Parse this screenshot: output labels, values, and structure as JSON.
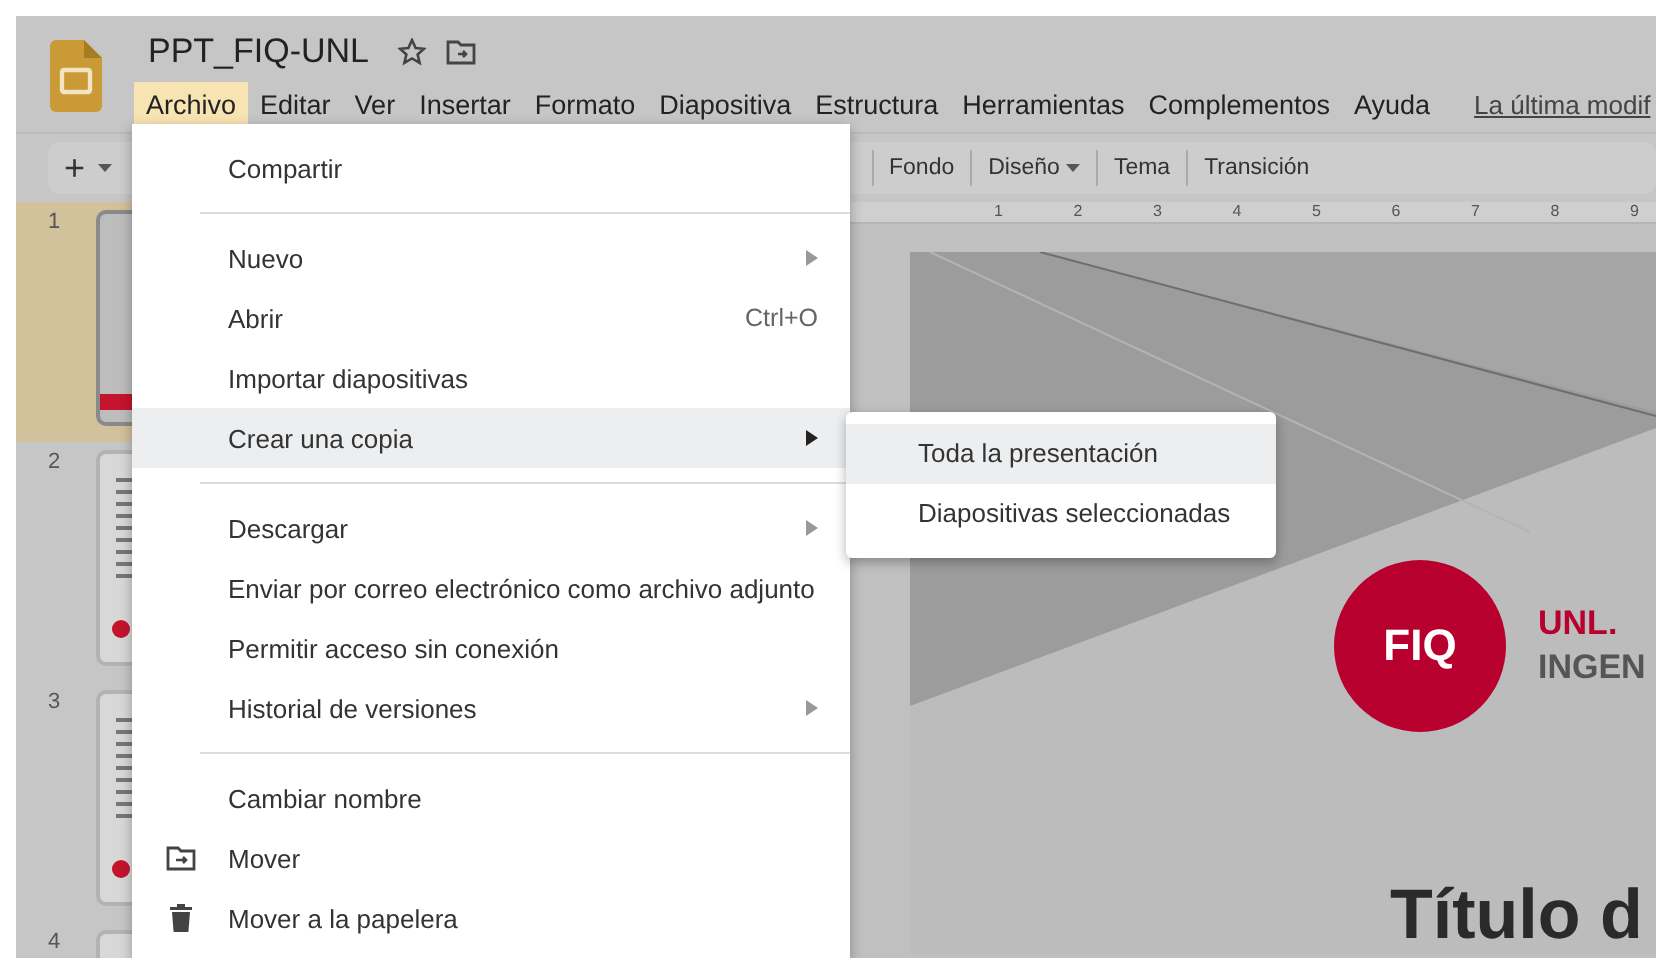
{
  "document": {
    "title": "PPT_FIQ-UNL",
    "starred": false,
    "last_edit": "La última modif"
  },
  "menus": [
    {
      "label": "Archivo",
      "selected": true
    },
    {
      "label": "Editar",
      "selected": false
    },
    {
      "label": "Ver",
      "selected": false
    },
    {
      "label": "Insertar",
      "selected": false
    },
    {
      "label": "Formato",
      "selected": false
    },
    {
      "label": "Diapositiva",
      "selected": false
    },
    {
      "label": "Estructura",
      "selected": false
    },
    {
      "label": "Herramientas",
      "selected": false
    },
    {
      "label": "Complementos",
      "selected": false
    },
    {
      "label": "Ayuda",
      "selected": false
    }
  ],
  "toolbar": {
    "add": "+",
    "tools": [
      {
        "label": "Fondo",
        "kind": "plain"
      },
      {
        "label": "Diseño",
        "kind": "dropdown"
      },
      {
        "label": "Tema",
        "kind": "plain"
      },
      {
        "label": "Transición",
        "kind": "plain"
      }
    ]
  },
  "ruler": [
    "1",
    "2",
    "3",
    "4",
    "5",
    "6",
    "7",
    "8",
    "9"
  ],
  "slides": [
    {
      "number": "1",
      "selected": true
    },
    {
      "number": "2",
      "selected": false
    },
    {
      "number": "3",
      "selected": false
    },
    {
      "number": "4",
      "selected": false
    }
  ],
  "slide": {
    "logo": "FIQ",
    "brand": "UNL.",
    "subtitle": "INGEN",
    "title": "Título d"
  },
  "file_menu": [
    {
      "kind": "entry",
      "label": "Compartir",
      "selected": false
    },
    {
      "kind": "divider"
    },
    {
      "kind": "submenu",
      "label": "Nuevo",
      "selected": false
    },
    {
      "kind": "entry",
      "label": "Abrir",
      "shortcut": "Ctrl+O",
      "selected": false
    },
    {
      "kind": "entry",
      "label": "Importar diapositivas",
      "selected": false
    },
    {
      "kind": "submenu",
      "label": "Crear una copia",
      "selected": true
    },
    {
      "kind": "divider"
    },
    {
      "kind": "submenu",
      "label": "Descargar",
      "selected": false
    },
    {
      "kind": "entry",
      "label": "Enviar por correo electrónico como archivo adjunto",
      "selected": false
    },
    {
      "kind": "entry",
      "label": "Permitir acceso sin conexión",
      "selected": false
    },
    {
      "kind": "submenu",
      "label": "Historial de versiones",
      "selected": false
    },
    {
      "kind": "divider"
    },
    {
      "kind": "entry",
      "label": "Cambiar nombre",
      "selected": false
    },
    {
      "kind": "move",
      "label": "Mover",
      "selected": false
    },
    {
      "kind": "trash",
      "label": "Mover a la papelera",
      "selected": false
    }
  ],
  "copy_submenu": [
    {
      "label": "Toda la presentación",
      "selected": true
    },
    {
      "label": "Diapositivas seleccionadas",
      "selected": false
    }
  ]
}
